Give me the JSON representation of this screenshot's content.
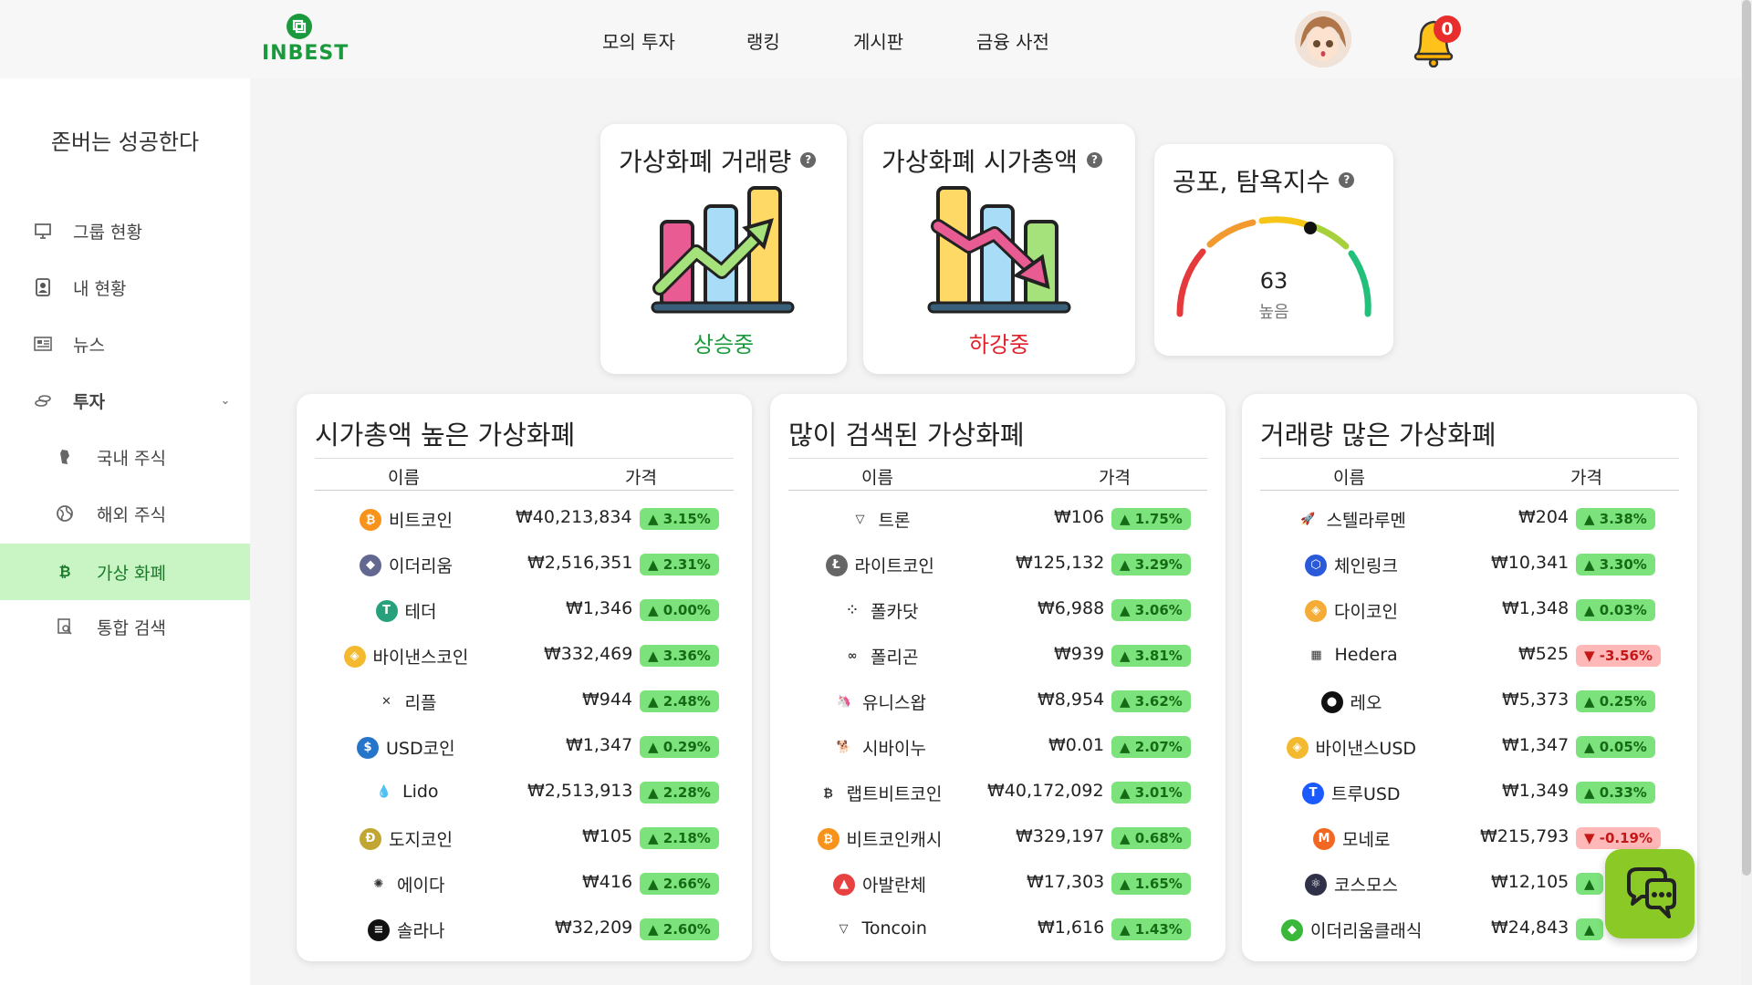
{
  "header": {
    "logo": "INBEST",
    "nav": [
      "모의 투자",
      "랭킹",
      "게시판",
      "금융 사전"
    ],
    "notifications": "0"
  },
  "sidebar": {
    "slogan": "존버는 성공한다",
    "items": [
      {
        "label": "그룹 현황",
        "icon": "monitor-icon"
      },
      {
        "label": "내 현황",
        "icon": "profile-card-icon"
      },
      {
        "label": "뉴스",
        "icon": "newspaper-icon"
      },
      {
        "label": "투자",
        "icon": "coins-icon",
        "expanded": true
      },
      {
        "label": "국내 주식",
        "icon": "korea-map-icon"
      },
      {
        "label": "해외 주식",
        "icon": "globe-icon"
      },
      {
        "label": "가상 화폐",
        "icon": "bitcoin-icon",
        "active": true
      },
      {
        "label": "통합 검색",
        "icon": "search-doc-icon"
      }
    ]
  },
  "widgets": {
    "volume": {
      "title": "가상화폐 거래량",
      "status": "상승중",
      "status_color": "#1a9a3c"
    },
    "marketcap": {
      "title": "가상화폐 시가총액",
      "status": "하강중",
      "status_color": "#e0202a"
    },
    "fear": {
      "title": "공포, 탐욕지수",
      "value": "63",
      "label": "높음"
    }
  },
  "tables": [
    {
      "title": "시가총액 높은 가상화폐",
      "col_name": "이름",
      "col_price": "가격",
      "rows": [
        {
          "name": "비트코인",
          "price": "₩40,213,834",
          "change": "▲ 3.15%",
          "dir": "up",
          "icon": "bitcoin-icon",
          "color": "#f7931a",
          "glyph": "₿"
        },
        {
          "name": "이더리움",
          "price": "₩2,516,351",
          "change": "▲ 2.31%",
          "dir": "up",
          "icon": "ethereum-icon",
          "color": "#62688f",
          "glyph": "◆"
        },
        {
          "name": "테더",
          "price": "₩1,346",
          "change": "▲ 0.00%",
          "dir": "up",
          "icon": "tether-icon",
          "color": "#26a17b",
          "glyph": "T"
        },
        {
          "name": "바이낸스코인",
          "price": "₩332,469",
          "change": "▲ 3.36%",
          "dir": "up",
          "icon": "binance-icon",
          "color": "#f3ba2f",
          "glyph": "◈"
        },
        {
          "name": "리플",
          "price": "₩944",
          "change": "▲ 2.48%",
          "dir": "up",
          "icon": "xrp-icon",
          "color": "#ffffff",
          "glyph": "✕"
        },
        {
          "name": "USD코인",
          "price": "₩1,347",
          "change": "▲ 0.29%",
          "dir": "up",
          "icon": "usdc-icon",
          "color": "#2775ca",
          "glyph": "$"
        },
        {
          "name": "Lido",
          "price": "₩2,513,913",
          "change": "▲ 2.28%",
          "dir": "up",
          "icon": "lido-icon",
          "color": "#ffffff",
          "glyph": "💧"
        },
        {
          "name": "도지코인",
          "price": "₩105",
          "change": "▲ 2.18%",
          "dir": "up",
          "icon": "dogecoin-icon",
          "color": "#c2a633",
          "glyph": "Ð"
        },
        {
          "name": "에이다",
          "price": "₩416",
          "change": "▲ 2.66%",
          "dir": "up",
          "icon": "cardano-icon",
          "color": "#ffffff",
          "glyph": "✺"
        },
        {
          "name": "솔라나",
          "price": "₩32,209",
          "change": "▲ 2.60%",
          "dir": "up",
          "icon": "solana-icon",
          "color": "#111111",
          "glyph": "≡"
        }
      ]
    },
    {
      "title": "많이 검색된 가상화폐",
      "col_name": "이름",
      "col_price": "가격",
      "rows": [
        {
          "name": "트론",
          "price": "₩106",
          "change": "▲ 1.75%",
          "dir": "up",
          "icon": "tron-icon",
          "color": "#ffffff",
          "glyph": "▽"
        },
        {
          "name": "라이트코인",
          "price": "₩125,132",
          "change": "▲ 3.29%",
          "dir": "up",
          "icon": "litecoin-icon",
          "color": "#666666",
          "glyph": "Ł"
        },
        {
          "name": "폴카닷",
          "price": "₩6,988",
          "change": "▲ 3.06%",
          "dir": "up",
          "icon": "polkadot-icon",
          "color": "#ffffff",
          "glyph": "⁘"
        },
        {
          "name": "폴리곤",
          "price": "₩939",
          "change": "▲ 3.81%",
          "dir": "up",
          "icon": "polygon-icon",
          "color": "#ffffff",
          "glyph": "∞"
        },
        {
          "name": "유니스왑",
          "price": "₩8,954",
          "change": "▲ 3.62%",
          "dir": "up",
          "icon": "uniswap-icon",
          "color": "#ffffff",
          "glyph": "🦄"
        },
        {
          "name": "시바이누",
          "price": "₩0.01",
          "change": "▲ 2.07%",
          "dir": "up",
          "icon": "shiba-icon",
          "color": "#ffffff",
          "glyph": "🐕"
        },
        {
          "name": "랩트비트코인",
          "price": "₩40,172,092",
          "change": "▲ 3.01%",
          "dir": "up",
          "icon": "wbtc-icon",
          "color": "#ffffff",
          "glyph": "₿"
        },
        {
          "name": "비트코인캐시",
          "price": "₩329,197",
          "change": "▲ 0.68%",
          "dir": "up",
          "icon": "bitcoin-cash-icon",
          "color": "#f7931a",
          "glyph": "₿"
        },
        {
          "name": "아발란체",
          "price": "₩17,303",
          "change": "▲ 1.65%",
          "dir": "up",
          "icon": "avalanche-icon",
          "color": "#e84142",
          "glyph": "▲"
        },
        {
          "name": "Toncoin",
          "price": "₩1,616",
          "change": "▲ 1.43%",
          "dir": "up",
          "icon": "toncoin-icon",
          "color": "#ffffff",
          "glyph": "▽"
        }
      ]
    },
    {
      "title": "거래량 많은 가상화폐",
      "col_name": "이름",
      "col_price": "가격",
      "rows": [
        {
          "name": "스텔라루멘",
          "price": "₩204",
          "change": "▲ 3.38%",
          "dir": "up",
          "icon": "stellar-icon",
          "color": "#ffffff",
          "glyph": "🚀"
        },
        {
          "name": "체인링크",
          "price": "₩10,341",
          "change": "▲ 3.30%",
          "dir": "up",
          "icon": "chainlink-icon",
          "color": "#2a5ada",
          "glyph": "⬡"
        },
        {
          "name": "다이코인",
          "price": "₩1,348",
          "change": "▲ 0.03%",
          "dir": "up",
          "icon": "dai-icon",
          "color": "#f5ac37",
          "glyph": "◈"
        },
        {
          "name": "Hedera",
          "price": "₩525",
          "change": "▼ -3.56%",
          "dir": "down",
          "icon": "hedera-icon",
          "color": "#ffffff",
          "glyph": "▦"
        },
        {
          "name": "레오",
          "price": "₩5,373",
          "change": "▲ 0.25%",
          "dir": "up",
          "icon": "leo-icon",
          "color": "#111111",
          "glyph": "●"
        },
        {
          "name": "바이낸스USD",
          "price": "₩1,347",
          "change": "▲ 0.05%",
          "dir": "up",
          "icon": "busd-icon",
          "color": "#f3ba2f",
          "glyph": "◈"
        },
        {
          "name": "트루USD",
          "price": "₩1,349",
          "change": "▲ 0.33%",
          "dir": "up",
          "icon": "trueusd-icon",
          "color": "#1a5aff",
          "glyph": "T"
        },
        {
          "name": "모네로",
          "price": "₩215,793",
          "change": "▼ -0.19%",
          "dir": "down",
          "icon": "monero-icon",
          "color": "#f26822",
          "glyph": "M"
        },
        {
          "name": "코스모스",
          "price": "₩12,105",
          "change": "▲",
          "dir": "up",
          "icon": "cosmos-icon",
          "color": "#2e3148",
          "glyph": "⚛"
        },
        {
          "name": "이더리움클래식",
          "price": "₩24,843",
          "change": "▲",
          "dir": "up",
          "icon": "ethereum-classic-icon",
          "color": "#3ab83a",
          "glyph": "◆"
        }
      ]
    }
  ]
}
